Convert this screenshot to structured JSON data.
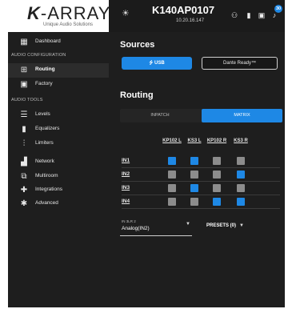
{
  "logo": {
    "brand_mark": "K",
    "brand_text": "-ARRAY",
    "tagline": "Unique Audio Solutions"
  },
  "sidebar": {
    "dashboard": "Dashboard",
    "section_audio_config": "AUDIO CONFIGURATION",
    "routing": "Routing",
    "factory": "Factory",
    "section_audio_tools": "AUDIO TOOLS",
    "levels": "Levels",
    "equalizers": "Equalizers",
    "limiters": "Limiters",
    "network": "Network",
    "multiroom": "Multiroom",
    "integrations": "Integrations",
    "advanced": "Advanced"
  },
  "header": {
    "device_name": "K140AP0107",
    "device_ip": "10.20.16.147",
    "notification_count": "30"
  },
  "sources": {
    "title": "Sources",
    "usb_label": "USB",
    "dante_label": "Dante Ready™"
  },
  "routing": {
    "title": "Routing",
    "inpatch_label": "INPATCH",
    "matrix_label": "MATRIX",
    "columns": [
      "KP102 L",
      "KS3 L",
      "KP102 R",
      "KS3 R"
    ],
    "rows": [
      {
        "label": "IN1",
        "cells": [
          true,
          true,
          false,
          false
        ]
      },
      {
        "label": "IN2",
        "cells": [
          false,
          false,
          false,
          true
        ]
      },
      {
        "label": "IN3",
        "cells": [
          false,
          true,
          false,
          false
        ]
      },
      {
        "label": "IN4",
        "cells": [
          false,
          false,
          true,
          true
        ]
      }
    ],
    "input_select_label": "IN 3LR 2",
    "input_select_value": "Analog(IN2)",
    "presets_label": "PRESETS (0)"
  },
  "colors": {
    "accent": "#1e88e5",
    "cell_off": "#8c8c8c",
    "background": "#1b1b1b"
  }
}
